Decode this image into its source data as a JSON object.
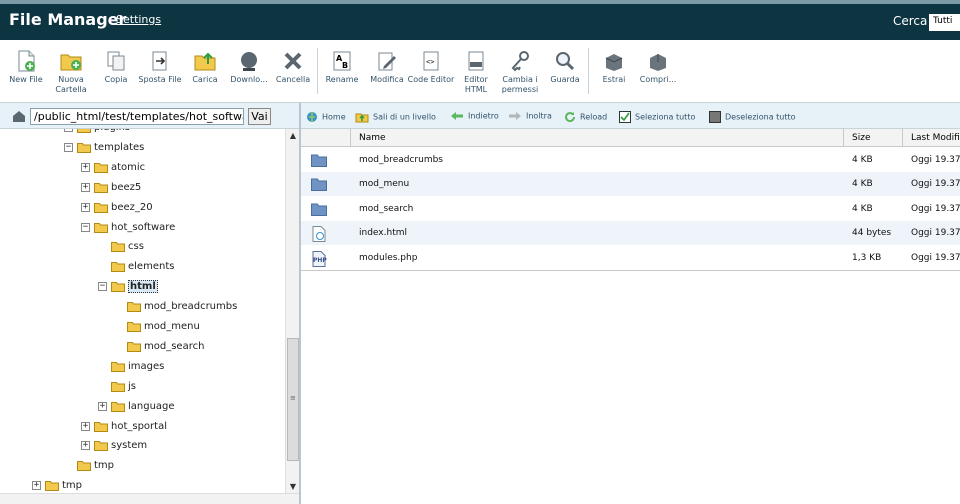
{
  "header": {
    "title": "File Manager",
    "settings_label": "Settings",
    "search_label": "Cerca",
    "search_scope": "Tutti"
  },
  "toolbar": {
    "buttons": [
      {
        "label": "New File",
        "icon": "new-file-icon"
      },
      {
        "label": "Nuova Cartella",
        "icon": "new-folder-icon"
      },
      {
        "label": "Copia",
        "icon": "copy-icon"
      },
      {
        "label": "Sposta File",
        "icon": "move-icon"
      },
      {
        "label": "Carica",
        "icon": "upload-icon"
      },
      {
        "label": "Downlo...",
        "icon": "download-icon"
      },
      {
        "label": "Cancella",
        "icon": "delete-icon"
      },
      {
        "label": "Rename",
        "icon": "rename-icon"
      },
      {
        "label": "Modifica",
        "icon": "edit-icon"
      },
      {
        "label": "Code Editor",
        "icon": "code-editor-icon"
      },
      {
        "label": "Editor HTML",
        "icon": "html-editor-icon"
      },
      {
        "label": "Cambia i permessi",
        "icon": "permissions-icon"
      },
      {
        "label": "Guarda",
        "icon": "view-icon"
      },
      {
        "label": "Estrai",
        "icon": "extract-icon"
      },
      {
        "label": "Compri...",
        "icon": "compress-icon"
      }
    ]
  },
  "path": {
    "value": "/public_html/test/templates/hot_software/html",
    "go_label": "Vai"
  },
  "nav": {
    "home": "Home",
    "up": "Sali di un livello",
    "back": "Indietro",
    "forward": "Inoltra",
    "reload": "Reload",
    "select_all": "Seleziona tutto",
    "deselect_all": "Deseleziona tutto"
  },
  "tree": {
    "items": [
      {
        "label": "plugins",
        "level": 2,
        "expander": "+"
      },
      {
        "label": "templates",
        "level": 2,
        "expander": "-"
      },
      {
        "label": "atomic",
        "level": 3,
        "expander": "+"
      },
      {
        "label": "beez5",
        "level": 3,
        "expander": "+"
      },
      {
        "label": "beez_20",
        "level": 3,
        "expander": "+"
      },
      {
        "label": "hot_software",
        "level": 3,
        "expander": "-"
      },
      {
        "label": "css",
        "level": 4,
        "expander": ""
      },
      {
        "label": "elements",
        "level": 4,
        "expander": ""
      },
      {
        "label": "html",
        "level": 4,
        "expander": "-",
        "selected": true
      },
      {
        "label": "mod_breadcrumbs",
        "level": 5,
        "expander": ""
      },
      {
        "label": "mod_menu",
        "level": 5,
        "expander": ""
      },
      {
        "label": "mod_search",
        "level": 5,
        "expander": ""
      },
      {
        "label": "images",
        "level": 4,
        "expander": ""
      },
      {
        "label": "js",
        "level": 4,
        "expander": ""
      },
      {
        "label": "language",
        "level": 4,
        "expander": "+"
      },
      {
        "label": "hot_sportal",
        "level": 3,
        "expander": "+"
      },
      {
        "label": "system",
        "level": 3,
        "expander": "+"
      },
      {
        "label": "tmp",
        "level": 2,
        "expander": ""
      },
      {
        "label": "tmp",
        "level": 1,
        "expander": "+"
      }
    ]
  },
  "files": {
    "columns": {
      "name": "Name",
      "size": "Size",
      "modified": "Last Modifi"
    },
    "rows": [
      {
        "name": "mod_breadcrumbs",
        "size": "4 KB",
        "modified": "Oggi 19.37",
        "type": "folder"
      },
      {
        "name": "mod_menu",
        "size": "4 KB",
        "modified": "Oggi 19.37",
        "type": "folder"
      },
      {
        "name": "mod_search",
        "size": "4 KB",
        "modified": "Oggi 19.37",
        "type": "folder"
      },
      {
        "name": "index.html",
        "size": "44 bytes",
        "modified": "Oggi 19.37",
        "type": "html"
      },
      {
        "name": "modules.php",
        "size": "1,3 KB",
        "modified": "Oggi 19.37",
        "type": "php"
      }
    ]
  },
  "colors": {
    "header_bg": "#0d3441",
    "folder_yellow": "#f2c94c",
    "folder_blue": "#6f93c2",
    "row_alt": "#eef4fa"
  }
}
